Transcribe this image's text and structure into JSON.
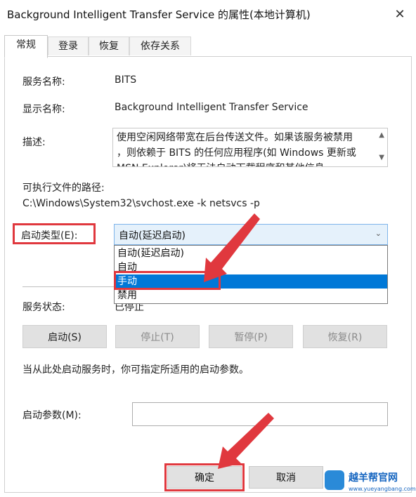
{
  "window": {
    "title": "Background Intelligent Transfer Service 的属性(本地计算机)",
    "close_glyph": "✕"
  },
  "tabs": [
    {
      "label": "常规",
      "active": true
    },
    {
      "label": "登录",
      "active": false
    },
    {
      "label": "恢复",
      "active": false
    },
    {
      "label": "依存关系",
      "active": false
    }
  ],
  "general": {
    "service_name_label": "服务名称:",
    "service_name_value": "BITS",
    "display_name_label": "显示名称:",
    "display_name_value": "Background Intelligent Transfer Service",
    "description_label": "描述:",
    "description_lines": [
      "使用空闲网络带宽在后台传送文件。如果该服务被禁用",
      "，则依赖于 BITS 的任何应用程序(如 Windows 更新或",
      "MSN Explorer)将无法自动下载程序和其他信息"
    ],
    "path_label": "可执行文件的路径:",
    "path_value": "C:\\Windows\\System32\\svchost.exe -k netsvcs -p",
    "startup_type_label": "启动类型(E):",
    "startup_type_selected": "自动(延迟启动)",
    "startup_options": [
      "自动(延迟启动)",
      "自动",
      "手动",
      "禁用"
    ],
    "highlighted_option": "手动",
    "status_label": "服务状态:",
    "status_value": "已停止",
    "buttons": {
      "start": "启动(S)",
      "stop": "停止(T)",
      "pause": "暂停(P)",
      "resume": "恢复(R)"
    },
    "hint": "当从此处启动服务时，你可指定所适用的启动参数。",
    "params_label": "启动参数(M):",
    "params_value": ""
  },
  "footer": {
    "ok": "确定",
    "cancel": "取消"
  },
  "watermark": {
    "text": "越羊帮官网",
    "url": "www.yueyangbang.com"
  },
  "colors": {
    "annotation_red": "#e0383e",
    "selection_blue": "#0078d7",
    "combo_bg": "#e5f1fb"
  },
  "icons": {
    "close": "close-icon",
    "chevron": "chevron-down-icon",
    "scroll_up": "scroll-up-icon",
    "scroll_down": "scroll-down-icon"
  }
}
